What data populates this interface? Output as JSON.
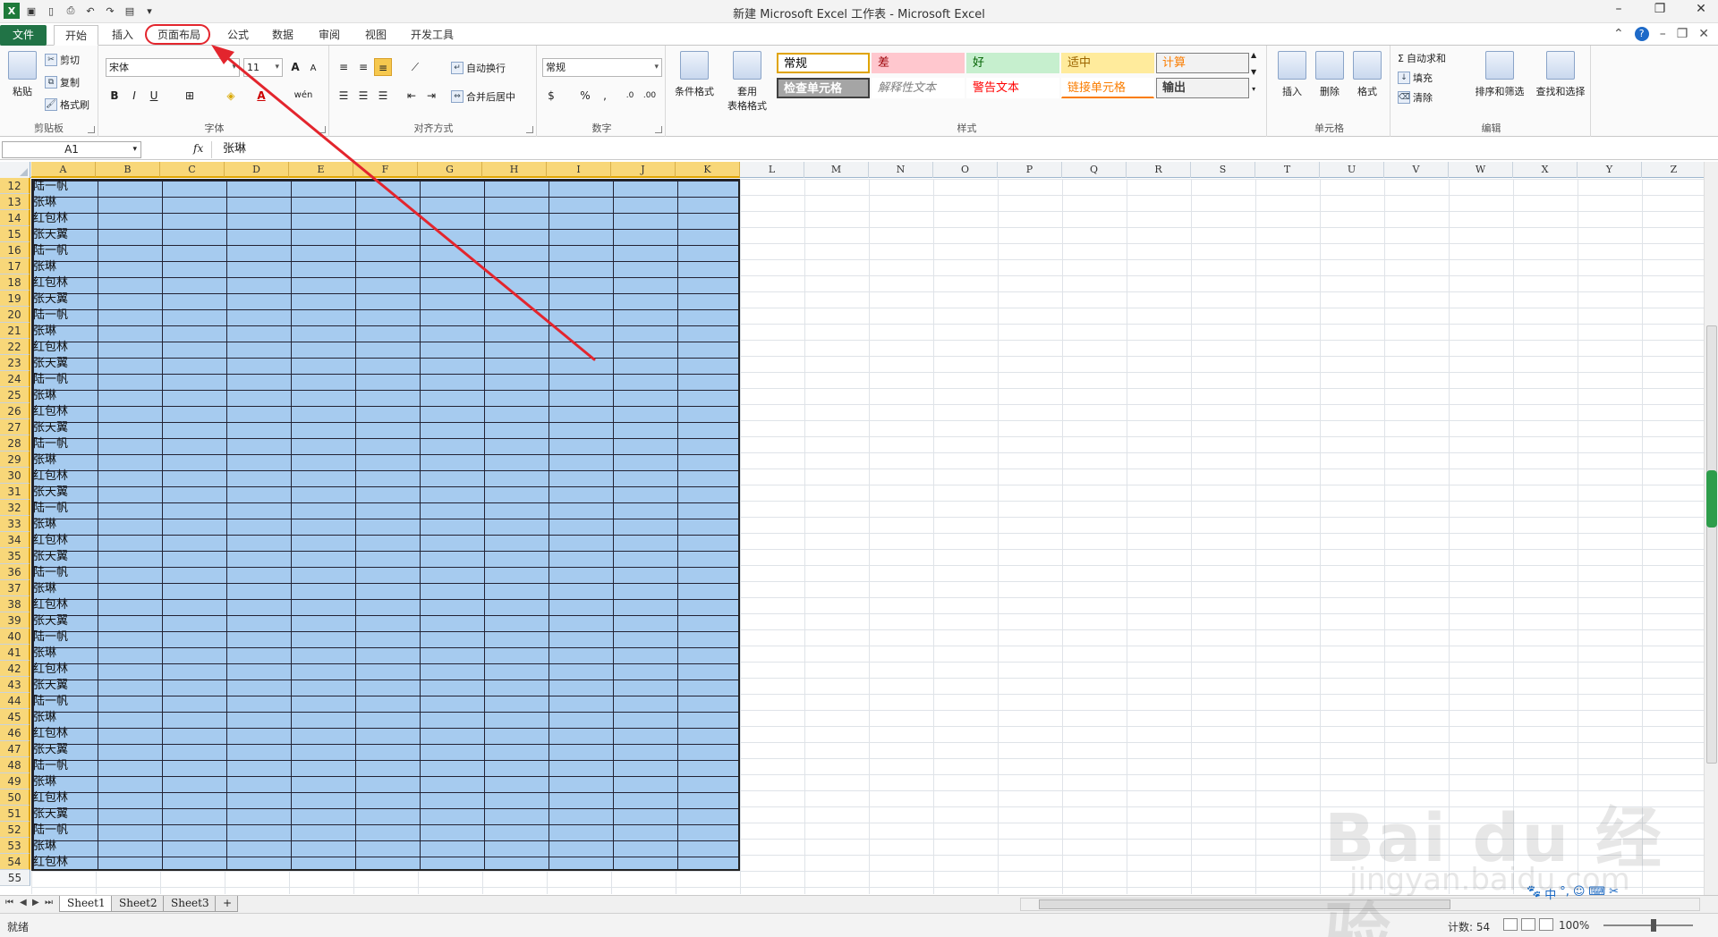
{
  "window": {
    "title": "新建 Microsoft Excel 工作表 - Microsoft Excel",
    "controls": [
      "–",
      "❐",
      "✕"
    ]
  },
  "ribbon_tabs": [
    "文件",
    "开始",
    "插入",
    "页面布局",
    "公式",
    "数据",
    "审阅",
    "视图",
    "开发工具"
  ],
  "clipboard": {
    "paste": "粘贴",
    "cut": "剪切",
    "copy": "复制",
    "painter": "格式刷",
    "label": "剪贴板"
  },
  "font": {
    "name": "宋体",
    "size": "11",
    "bold": "B",
    "italic": "I",
    "underline": "U",
    "grow": "A",
    "shrink": "A",
    "phonetic": "wén",
    "label": "字体"
  },
  "alignment": {
    "wrap": "自动换行",
    "merge": "合并后居中",
    "label": "对齐方式"
  },
  "number": {
    "format": "常规",
    "percent": "%",
    "comma": ",",
    "label": "数字"
  },
  "styles": {
    "cond_format": "条件格式",
    "table_format": "套用\n表格格式",
    "cells": [
      {
        "text": "常规",
        "bg": "#ffffff",
        "color": "#000000"
      },
      {
        "text": "差",
        "bg": "#ffc7ce",
        "color": "#9c0006"
      },
      {
        "text": "好",
        "bg": "#c6efce",
        "color": "#006100"
      },
      {
        "text": "适中",
        "bg": "#ffeb9c",
        "color": "#9c6500"
      },
      {
        "text": "计算",
        "bg": "#f2f2f2",
        "color": "#fa7d00"
      },
      {
        "text": "检查单元格",
        "bg": "#a5a5a5",
        "color": "#ffffff"
      },
      {
        "text": "解释性文本",
        "bg": "#ffffff",
        "color": "#7f7f7f"
      },
      {
        "text": "警告文本",
        "bg": "#ffffff",
        "color": "#ff0000"
      },
      {
        "text": "链接单元格",
        "bg": "#ffffff",
        "color": "#fa7d00"
      },
      {
        "text": "输出",
        "bg": "#f2f2f2",
        "color": "#3f3f3f"
      }
    ],
    "label": "样式"
  },
  "cells_group": {
    "insert": "插入",
    "delete": "删除",
    "format": "格式",
    "label": "单元格"
  },
  "editing": {
    "autosum": "自动求和",
    "fill": "填充",
    "clear": "清除",
    "sort": "排序和筛选",
    "find": "查找和选择",
    "label": "编辑"
  },
  "formula_bar": {
    "name_box": "A1",
    "fx": "fx",
    "content": "张琳"
  },
  "columns": [
    "A",
    "B",
    "C",
    "D",
    "E",
    "F",
    "G",
    "H",
    "I",
    "J",
    "K",
    "L",
    "M",
    "N",
    "O",
    "P",
    "Q",
    "R",
    "S",
    "T",
    "U",
    "V",
    "W",
    "X",
    "Y",
    "Z"
  ],
  "rows": [
    {
      "num": "12",
      "a": "陆一帆"
    },
    {
      "num": "13",
      "a": "张琳"
    },
    {
      "num": "14",
      "a": "红包林"
    },
    {
      "num": "15",
      "a": "张天翼"
    },
    {
      "num": "16",
      "a": "陆一帆"
    },
    {
      "num": "17",
      "a": "张琳"
    },
    {
      "num": "18",
      "a": "红包林"
    },
    {
      "num": "19",
      "a": "张天翼"
    },
    {
      "num": "20",
      "a": "陆一帆"
    },
    {
      "num": "21",
      "a": "张琳"
    },
    {
      "num": "22",
      "a": "红包林"
    },
    {
      "num": "23",
      "a": "张天翼"
    },
    {
      "num": "24",
      "a": "陆一帆"
    },
    {
      "num": "25",
      "a": "张琳"
    },
    {
      "num": "26",
      "a": "红包林"
    },
    {
      "num": "27",
      "a": "张天翼"
    },
    {
      "num": "28",
      "a": "陆一帆"
    },
    {
      "num": "29",
      "a": "张琳"
    },
    {
      "num": "30",
      "a": "红包林"
    },
    {
      "num": "31",
      "a": "张天翼"
    },
    {
      "num": "32",
      "a": "陆一帆"
    },
    {
      "num": "33",
      "a": "张琳"
    },
    {
      "num": "34",
      "a": "红包林"
    },
    {
      "num": "35",
      "a": "张天翼"
    },
    {
      "num": "36",
      "a": "陆一帆"
    },
    {
      "num": "37",
      "a": "张琳"
    },
    {
      "num": "38",
      "a": "红包林"
    },
    {
      "num": "39",
      "a": "张天翼"
    },
    {
      "num": "40",
      "a": "陆一帆"
    },
    {
      "num": "41",
      "a": "张琳"
    },
    {
      "num": "42",
      "a": "红包林"
    },
    {
      "num": "43",
      "a": "张天翼"
    },
    {
      "num": "44",
      "a": "陆一帆"
    },
    {
      "num": "45",
      "a": "张琳"
    },
    {
      "num": "46",
      "a": "红包林"
    },
    {
      "num": "47",
      "a": "张天翼"
    },
    {
      "num": "48",
      "a": "陆一帆"
    },
    {
      "num": "49",
      "a": "张琳"
    },
    {
      "num": "50",
      "a": "红包林"
    },
    {
      "num": "51",
      "a": "张天翼"
    },
    {
      "num": "52",
      "a": "陆一帆"
    },
    {
      "num": "53",
      "a": "张琳"
    },
    {
      "num": "54",
      "a": "红包林"
    },
    {
      "num": "55",
      "a": ""
    }
  ],
  "sheets": [
    "Sheet1",
    "Sheet2",
    "Sheet3"
  ],
  "status": {
    "ready": "就绪",
    "count": "计数: 54",
    "zoom": "100%"
  },
  "watermark": {
    "text": "Bai du 经验",
    "sub": "jingyan.baidu.com"
  },
  "ime": [
    "中",
    "°,",
    "☺",
    "⌨",
    "✂"
  ]
}
